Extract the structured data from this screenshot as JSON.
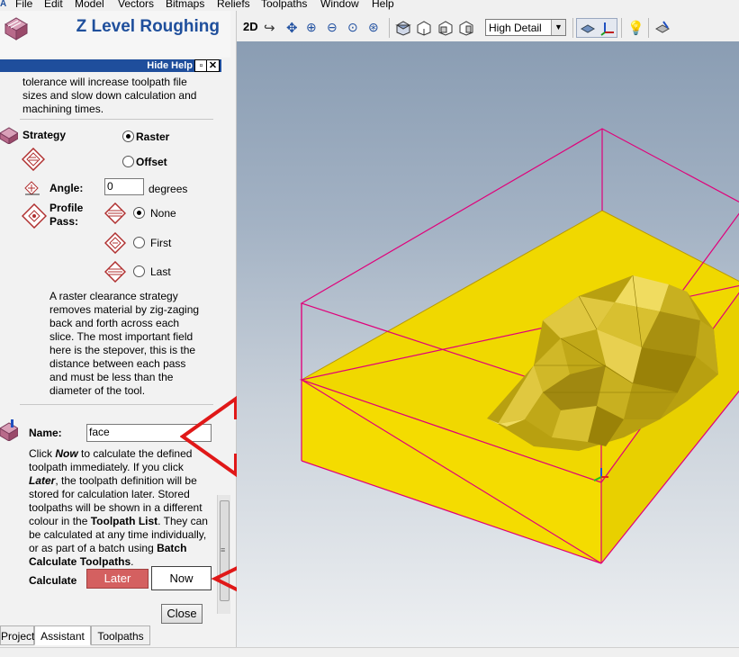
{
  "menu": [
    "File",
    "Edit",
    "Model",
    "Vectors",
    "Bitmaps",
    "Reliefs",
    "Toolpaths",
    "Window",
    "Help"
  ],
  "panel": {
    "title": "Z Level Roughing",
    "hide_help": "Hide Help",
    "close_x": "✕",
    "help_text_top": [
      "tolerance will increase toolpath file",
      "sizes and slow down calculation and",
      "machining times."
    ],
    "strategy_label": "Strategy",
    "raster_label": "Raster",
    "offset_label": "Offset",
    "angle_label": "Angle:",
    "angle_value": "0",
    "angle_unit": "degrees",
    "profile_label_1": "Profile",
    "profile_label_2": "Pass:",
    "profile_none": "None",
    "profile_first": "First",
    "profile_last": "Last",
    "raster_help": [
      "A raster clearance strategy",
      "removes material by zig-zaging",
      "back and forth across each",
      "slice. The most important field",
      "here is the stepover, this is the",
      "distance between each pass",
      "and must be less than the",
      "diameter of the tool."
    ],
    "name_label": "Name:",
    "name_value": "face",
    "calc_help": [
      [
        "Click ",
        "Now",
        " to calculate the defined"
      ],
      [
        "toolpath immediately. If you click"
      ],
      [
        "",
        "Later",
        ", the toolpath definition will be"
      ],
      [
        "stored for calculation later. Stored"
      ],
      [
        "toolpaths will be shown in a different"
      ],
      [
        "colour in the ",
        "Toolpath List",
        ". They can"
      ],
      [
        "be calculated at any time individually,"
      ],
      [
        "or as part of a batch using ",
        "Batch",
        ""
      ],
      [
        "",
        "Calculate Toolpaths",
        "."
      ]
    ],
    "calculate_label": "Calculate",
    "later_button": "Later",
    "now_button": "Now",
    "close_button": "Close",
    "tabs": [
      "Project",
      "Assistant",
      "Toolpaths"
    ]
  },
  "toolbar": {
    "view_2d": "2D",
    "detail_select": "High Detail"
  },
  "colors": {
    "title_blue": "#1f4f9c",
    "help_bar": "#1f4e9c",
    "later_red": "#d46060",
    "arrow_red": "#e01818",
    "material_yellow": "#f0d800",
    "bbox_magenta": "#e0007a"
  }
}
